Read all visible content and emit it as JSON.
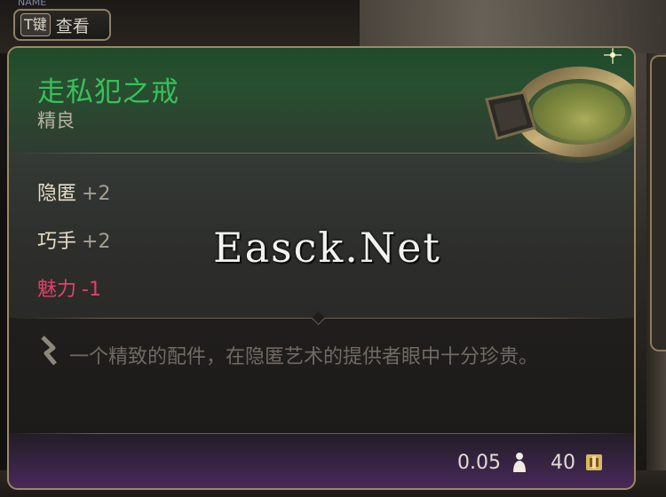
{
  "key_hint": {
    "key": "T键",
    "label": "查看",
    "faded_top_text": "NAME"
  },
  "item": {
    "name": "走私犯之戒",
    "rarity": "精良",
    "stats": [
      {
        "name": "隐匿",
        "value": "+2",
        "negative": false
      },
      {
        "name": "巧手",
        "value": "+2",
        "negative": false
      },
      {
        "name": "魅力",
        "value": "-1",
        "negative": true
      }
    ],
    "description": "一个精致的配件，在隐匿艺术的提供者眼中十分珍贵。",
    "weight": "0.05",
    "price": "40"
  },
  "watermark": "Easck.Net",
  "colors": {
    "name_green": "#37c15a",
    "negative_red": "#e2416a",
    "border_gold": "#9c8a66",
    "footer_purple": "#4a2a5c"
  },
  "icons": {
    "description": "description-chevron-icon",
    "weight": "weight-icon",
    "price": "gold-coin-icon",
    "ring": "ring-item-art"
  }
}
